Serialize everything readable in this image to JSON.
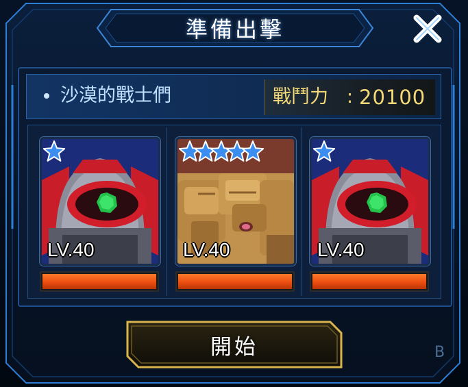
{
  "dialog": {
    "title": "準備出擊",
    "close_icon": "close-x-icon"
  },
  "team": {
    "name": "沙漠的戰士們",
    "power_label": "戰鬥力",
    "power_colon": ":",
    "power_value": "20100"
  },
  "units": [
    {
      "level": "LV.40",
      "stars": 1,
      "portrait": "red-mobile-suit-portrait",
      "hp_fraction": 1.0
    },
    {
      "level": "LV.40",
      "stars": 5,
      "portrait": "tan-desert-mobile-suit-portrait",
      "hp_fraction": 1.0
    },
    {
      "level": "LV.40",
      "stars": 1,
      "portrait": "red-mobile-suit-portrait",
      "hp_fraction": 1.0
    }
  ],
  "start_button": {
    "label": "開始"
  },
  "corner_letter": "B",
  "colors": {
    "accent_blue": "#1d5fa8",
    "power_gold": "#f3d978",
    "hp_orange": "#e94a0e",
    "star_blue": "#3b8ef0"
  }
}
